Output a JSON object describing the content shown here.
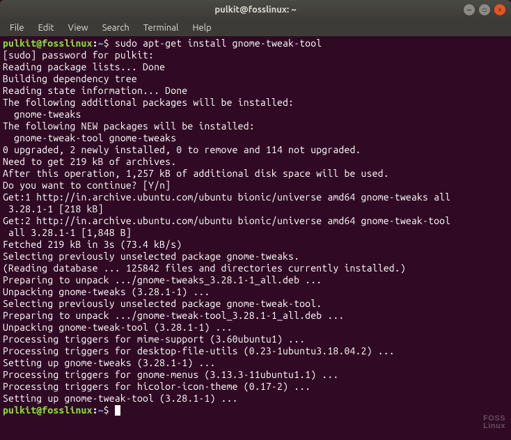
{
  "window": {
    "title": "pulkit@fosslinux: ~"
  },
  "menubar": {
    "file": "File",
    "edit": "Edit",
    "view": "View",
    "search": "Search",
    "terminal": "Terminal",
    "help": "Help"
  },
  "prompt": {
    "user_host": "pulkit@fosslinux",
    "colon": ":",
    "path": "~",
    "dollar": "$ "
  },
  "lines": {
    "l0_cmd": "sudo apt-get install gnome-tweak-tool",
    "l1": "[sudo] password for pulkit: ",
    "l2": "Reading package lists... Done",
    "l3": "Building dependency tree       ",
    "l4": "Reading state information... Done",
    "l5": "The following additional packages will be installed:",
    "l6": "  gnome-tweaks",
    "l7": "The following NEW packages will be installed:",
    "l8": "  gnome-tweak-tool gnome-tweaks",
    "l9": "0 upgraded, 2 newly installed, 0 to remove and 114 not upgraded.",
    "l10": "Need to get 219 kB of archives.",
    "l11": "After this operation, 1,257 kB of additional disk space will be used.",
    "l12": "Do you want to continue? [Y/n] ",
    "l13": "Get:1 http://in.archive.ubuntu.com/ubuntu bionic/universe amd64 gnome-tweaks all",
    "l14": " 3.28.1-1 [218 kB]",
    "l15": "Get:2 http://in.archive.ubuntu.com/ubuntu bionic/universe amd64 gnome-tweak-tool",
    "l16": " all 3.28.1-1 [1,848 B]",
    "l17": "Fetched 219 kB in 3s (73.4 kB/s)",
    "l18": "Selecting previously unselected package gnome-tweaks.",
    "l19": "(Reading database ... 125842 files and directories currently installed.)",
    "l20": "Preparing to unpack .../gnome-tweaks_3.28.1-1_all.deb ...",
    "l21": "Unpacking gnome-tweaks (3.28.1-1) ...",
    "l22": "Selecting previously unselected package gnome-tweak-tool.",
    "l23": "Preparing to unpack .../gnome-tweak-tool_3.28.1-1_all.deb ...",
    "l24": "Unpacking gnome-tweak-tool (3.28.1-1) ...",
    "l25": "Processing triggers for mime-support (3.60ubuntu1) ...",
    "l26": "Processing triggers for desktop-file-utils (0.23-1ubuntu3.18.04.2) ...",
    "l27": "Setting up gnome-tweaks (3.28.1-1) ...",
    "l28": "Processing triggers for gnome-menus (3.13.3-11ubuntu1.1) ...",
    "l29": "Processing triggers for hicolor-icon-theme (0.17-2) ...",
    "l30": "Setting up gnome-tweak-tool (3.28.1-1) ..."
  },
  "watermark": {
    "l1": "FOSS",
    "l2": "Linux"
  }
}
